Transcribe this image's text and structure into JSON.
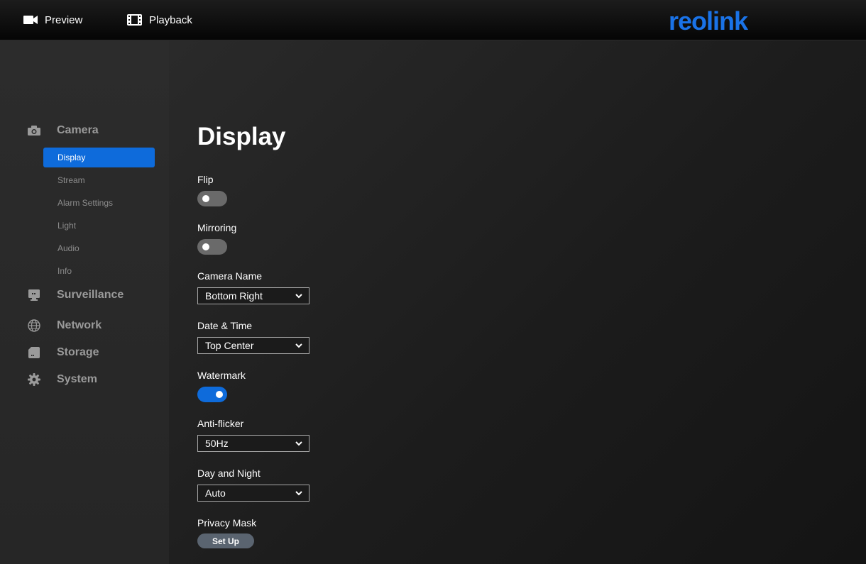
{
  "topbar": {
    "preview_label": "Preview",
    "playback_label": "Playback",
    "logo_text": "reolink"
  },
  "sidebar": {
    "sections": [
      {
        "label": "Camera",
        "icon": "camera-icon"
      },
      {
        "label": "Surveillance",
        "icon": "monitor-icon"
      },
      {
        "label": "Network",
        "icon": "globe-icon"
      },
      {
        "label": "Storage",
        "icon": "sd-card-icon"
      },
      {
        "label": "System",
        "icon": "gear-icon"
      }
    ],
    "camera_items": [
      {
        "label": "Display",
        "active": true
      },
      {
        "label": "Stream"
      },
      {
        "label": "Alarm Settings"
      },
      {
        "label": "Light"
      },
      {
        "label": "Audio"
      },
      {
        "label": "Info"
      }
    ]
  },
  "main": {
    "title": "Display",
    "flip": {
      "label": "Flip",
      "on": false
    },
    "mirroring": {
      "label": "Mirroring",
      "on": false
    },
    "camera_name": {
      "label": "Camera Name",
      "value": "Bottom Right"
    },
    "date_time": {
      "label": "Date & Time",
      "value": "Top Center"
    },
    "watermark": {
      "label": "Watermark",
      "on": true
    },
    "anti_flicker": {
      "label": "Anti-flicker",
      "value": "50Hz"
    },
    "day_night": {
      "label": "Day and Night",
      "value": "Auto"
    },
    "privacy_mask": {
      "label": "Privacy Mask",
      "button": "Set Up"
    }
  },
  "colors": {
    "accent": "#0e6bdb",
    "logo": "#1a73e8"
  }
}
